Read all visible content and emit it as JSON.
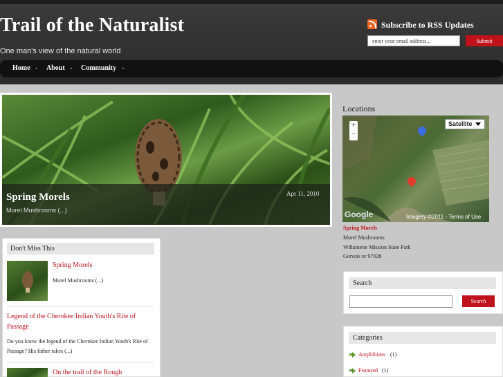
{
  "header": {
    "site_title": "Trail of the Naturalist",
    "tagline": "One man's view of the natural world",
    "rss_label": "Subscribe to RSS Updates",
    "email_placeholder": "enter your email address...",
    "submit_label": "Submit",
    "icon": "rss-icon"
  },
  "nav": {
    "items": [
      {
        "label": "Home",
        "sep": "-"
      },
      {
        "label": "About",
        "sep": "-"
      },
      {
        "label": "Community",
        "sep": "-"
      }
    ]
  },
  "featured": {
    "title": "Spring Morels",
    "date": "Apr 11, 2010",
    "excerpt": "Morel Mushrooms (...)"
  },
  "dont_miss": {
    "heading": "Don't Miss This",
    "posts": [
      {
        "title": "Spring Morels",
        "excerpt": "Morel Mushrooms (...)"
      },
      {
        "title": "Legend of the Cherokee Indian Youth's Rite of Passage",
        "excerpt": "Do you know the legend of the Cherokee Indian Youth's Rite of Passage? His father takes (...)"
      },
      {
        "title": "On the trail of the Rough"
      }
    ]
  },
  "locations": {
    "heading": "Locations",
    "map_type": "Satellite",
    "zoom_in": "+",
    "zoom_out": "−",
    "map_logo": "Google",
    "map_credit": "Imagery ©2011 - Terms of Use",
    "place_title": "Spring Morels",
    "address": [
      "Morel Mushrooms",
      "Willamette Mission State Park",
      "Gervais or 97026"
    ]
  },
  "search": {
    "heading": "Search",
    "button": "Search"
  },
  "categories": {
    "heading": "Categories",
    "items": [
      {
        "label": "Amphibians",
        "count": "(1)"
      },
      {
        "label": "Featured",
        "count": "(1)"
      }
    ]
  },
  "colors": {
    "accent": "#c0121b",
    "header_bg": "#2b2b2b",
    "page_bg": "#c8c8c8"
  }
}
